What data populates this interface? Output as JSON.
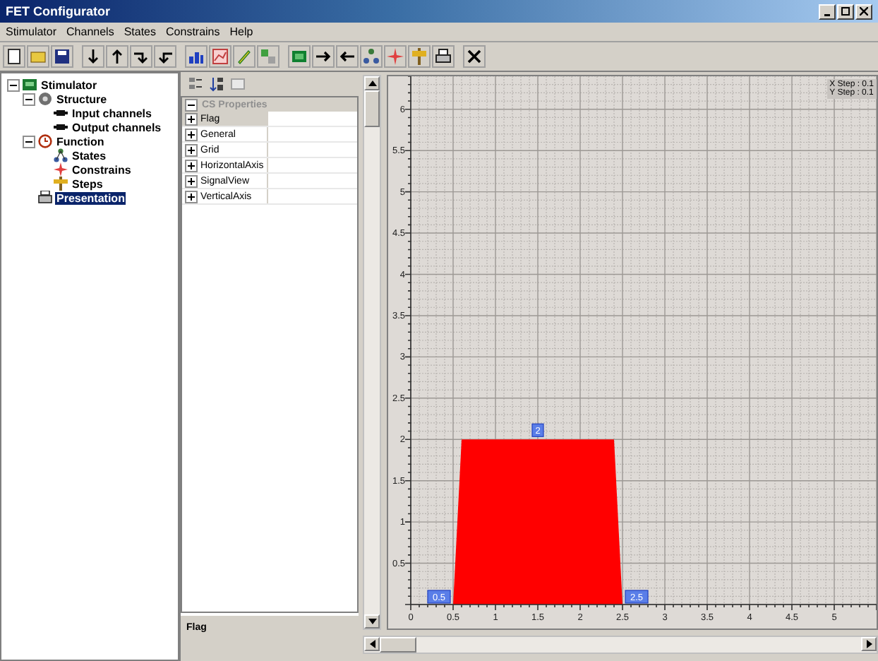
{
  "window": {
    "title": "FET Configurator"
  },
  "menu": [
    "Stimulator",
    "Channels",
    "States",
    "Constrains",
    "Help"
  ],
  "tree": [
    {
      "label": "Stimulator",
      "kind": "root",
      "expanded": true,
      "selected": false,
      "children": [
        {
          "label": "Structure",
          "kind": "structure",
          "expanded": true,
          "selected": false,
          "children": [
            {
              "label": "Input channels",
              "kind": "channel",
              "selected": false
            },
            {
              "label": "Output channels",
              "kind": "channel",
              "selected": false
            }
          ]
        },
        {
          "label": "Function",
          "kind": "function",
          "expanded": true,
          "selected": false,
          "children": [
            {
              "label": "States",
              "kind": "states",
              "selected": false
            },
            {
              "label": "Constrains",
              "kind": "constraints",
              "selected": false
            },
            {
              "label": "Steps",
              "kind": "steps",
              "selected": false
            }
          ]
        },
        {
          "label": "Presentation",
          "kind": "presentation",
          "selected": true
        }
      ]
    }
  ],
  "properties": {
    "header": "CS Properties",
    "rows": [
      {
        "name": "Flag",
        "selected": true
      },
      {
        "name": "General",
        "selected": false
      },
      {
        "name": "Grid",
        "selected": false
      },
      {
        "name": "HorizontalAxis",
        "selected": false
      },
      {
        "name": "SignalView",
        "selected": false
      },
      {
        "name": "VerticalAxis",
        "selected": false
      }
    ],
    "description": "Flag"
  },
  "plot": {
    "steps": [
      "X Step : 0.1",
      "Y Step : 0.1"
    ],
    "chart_data": {
      "type": "area",
      "x": [
        0.5,
        0.6,
        2.4,
        2.5
      ],
      "series": [
        {
          "color": "#ff0000",
          "values": [
            0,
            2,
            2,
            0
          ]
        }
      ],
      "grid": true,
      "xlim": [
        0,
        5.6
      ],
      "ylim": [
        0,
        6.4
      ],
      "xticks": [
        0,
        {
          "value": 0.5,
          "label": "0.5"
        },
        1,
        {
          "value": 1.5,
          "label": "1.5"
        },
        2,
        {
          "value": 2.5,
          "label": "2.5"
        },
        3,
        {
          "value": 3.5,
          "label": "3.5"
        },
        4,
        {
          "value": 4.5,
          "label": "4.5"
        },
        5
      ],
      "yticks": [
        {
          "value": 0.5,
          "label": "0.5"
        },
        1,
        {
          "value": 1.5,
          "label": "1.5"
        },
        2,
        {
          "value": 2.5,
          "label": "2.5"
        },
        3,
        {
          "value": 3.5,
          "label": "3.5"
        },
        4,
        {
          "value": 4.5,
          "label": "4.5"
        },
        5,
        {
          "value": 5.5,
          "label": "5.5"
        },
        6
      ],
      "annotations": [
        {
          "x": 0.5,
          "y": 0,
          "text": "0.5"
        },
        {
          "x": 1.5,
          "y": 2,
          "text": "2"
        },
        {
          "x": 2.5,
          "y": 0,
          "text": "2.5"
        }
      ]
    }
  }
}
